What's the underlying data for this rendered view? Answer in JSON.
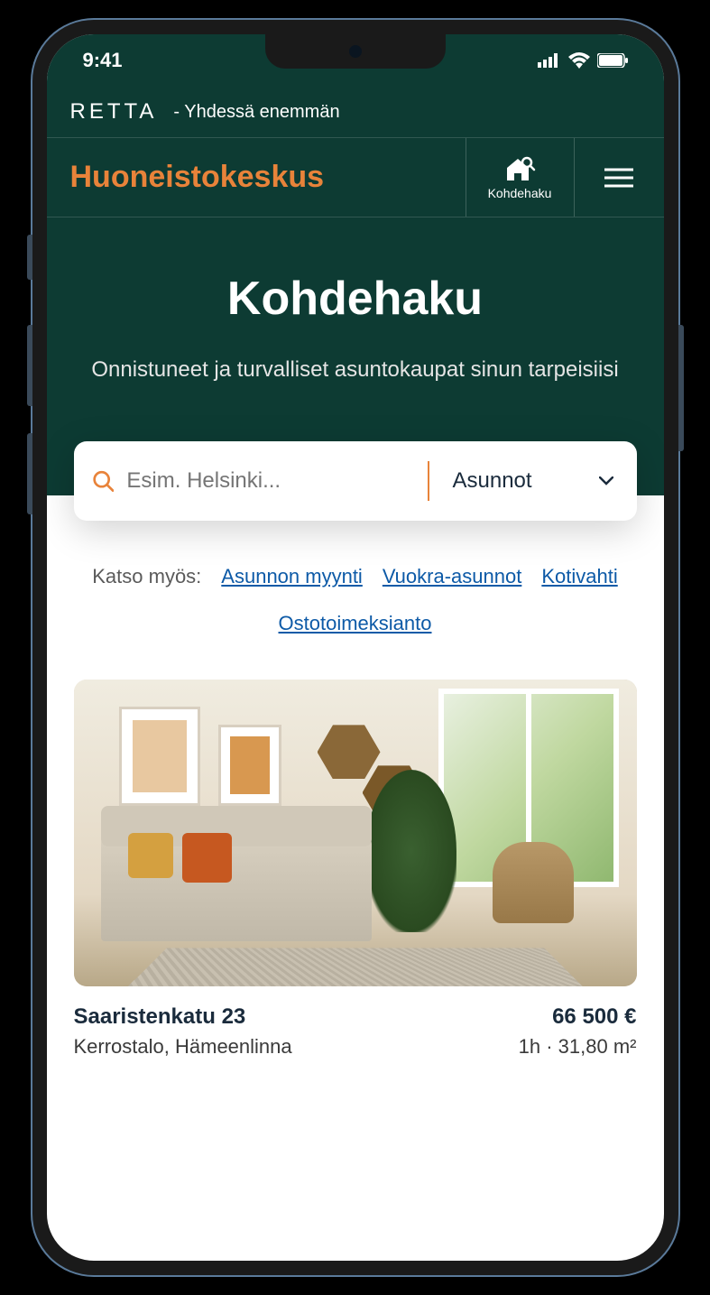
{
  "status_bar": {
    "time": "9:41"
  },
  "top_banner": {
    "logo": "RETTA",
    "tagline": "- Yhdessä enemmän"
  },
  "nav": {
    "brand": "Huoneistokeskus",
    "search_label": "Kohdehaku"
  },
  "hero": {
    "title": "Kohdehaku",
    "subtitle": "Onnistuneet ja turvalliset asuntokaupat sinun tarpeisiisi"
  },
  "search": {
    "placeholder": "Esim. Helsinki...",
    "category": "Asunnot"
  },
  "links": {
    "label": "Katso myös:",
    "items": [
      "Asunnon myynti",
      "Vuokra-asunnot",
      "Kotivahti",
      "Ostotoimeksianto"
    ]
  },
  "listing": {
    "title": "Saaristenkatu 23",
    "subtitle": "Kerrostalo, Hämeenlinna",
    "price": "66 500 €",
    "details": "1h · 31,80 m²"
  }
}
